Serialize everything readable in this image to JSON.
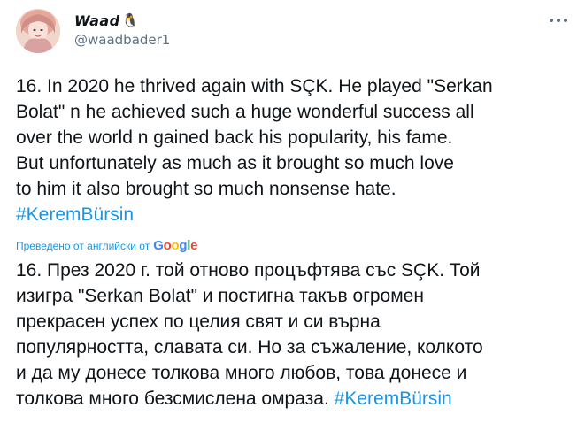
{
  "tweet": {
    "author": {
      "display_name": "Waad",
      "emoji": "🐧",
      "handle": "@waadbader1"
    },
    "original_lines": [
      "16. In 2020 he thrived again with SÇK. He played \"Serkan",
      "Bolat\" n he achieved such a huge wonderful success all",
      "over the world n gained back his popularity, his fame.",
      "But unfortunately as much as it brought so much love",
      "to him it also brought so much nonsense hate."
    ],
    "original_hashtag": "#KeremBürsin",
    "translated_by_label": "Преведено от английски от",
    "google_logo": [
      "G",
      "o",
      "o",
      "g",
      "l",
      "e"
    ],
    "translated_lines": [
      "16. През 2020 г. той отново процъфтява със SÇK. Той",
      "изигра \"Serkan Bolat\" и постигна такъв огромен",
      "прекрасен успех по целия свят и си върна",
      "популярността, славата си. Но за съжаление, колкото",
      "и да му донесе толкова много любов, това донесе и"
    ],
    "translated_last_line": "толкова много безсмислена омраза.",
    "translated_hashtag": "#KeremBürsin"
  },
  "colors": {
    "link": "#1b95e0",
    "secondary_text": "#5b7083",
    "primary_text": "#0f1419"
  },
  "icons": {
    "more": "more-horizontal-icon"
  }
}
